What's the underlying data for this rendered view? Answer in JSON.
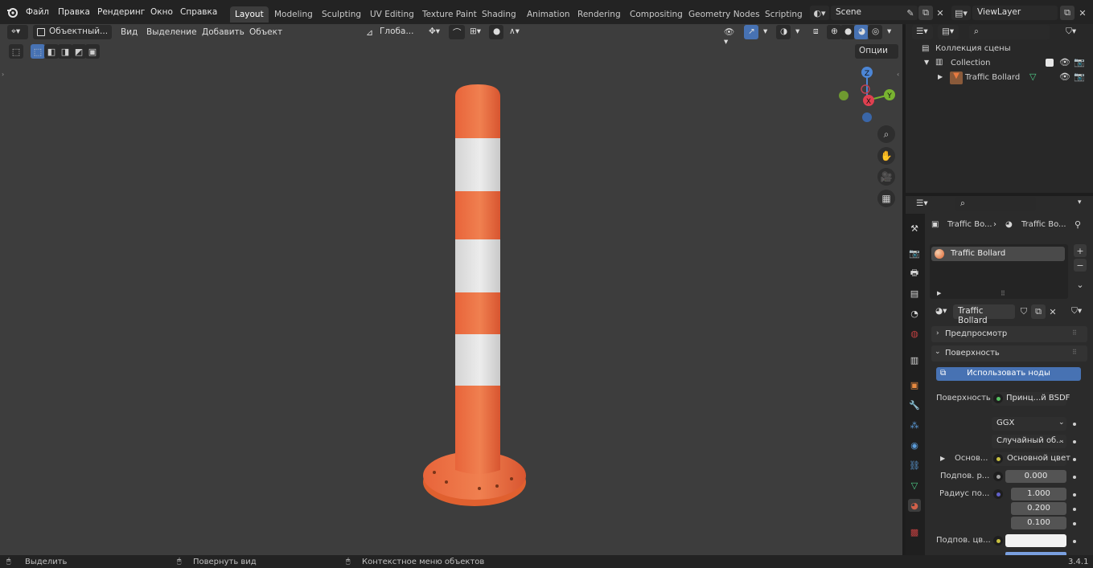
{
  "topbar": {
    "menus": [
      "Файл",
      "Правка",
      "Рендеринг",
      "Окно",
      "Справка"
    ],
    "workspaces": [
      "Layout",
      "Modeling",
      "Sculpting",
      "UV Editing",
      "Texture Paint",
      "Shading",
      "Animation",
      "Rendering",
      "Compositing",
      "Geometry Nodes",
      "Scripting"
    ],
    "active_workspace": "Layout",
    "scene": "Scene",
    "view_layer": "ViewLayer"
  },
  "viewport_header": {
    "mode": "Объектный...",
    "menus": [
      "Вид",
      "Выделение",
      "Добавить",
      "Объект"
    ],
    "orientation": "Глоба...",
    "options": "Опции"
  },
  "gizmo": {
    "z": "Z",
    "y": "Y",
    "x": "X"
  },
  "outliner": {
    "scene_collection": "Коллекция сцены",
    "collection": "Collection",
    "object": "Traffic Bollard"
  },
  "properties": {
    "breadcrumb_object": "Traffic Bo...",
    "breadcrumb_material": "Traffic Bo...",
    "material_slot": "Traffic Bollard",
    "material_name": "Traffic Bollard",
    "panel_preview": "Предпросмотр",
    "panel_surface": "Поверхность",
    "use_nodes_button": "Использовать ноды",
    "surface_label": "Поверхность",
    "surface_value": "Принц...й BSDF",
    "distribution": "GGX",
    "subsurface_method": "Случайный об...",
    "base_label": "Основ...",
    "base_value": "Основной цвет",
    "subsurface_label": "Подпов. р...",
    "subsurface_value": "0.000",
    "radius_label": "Радиус по...",
    "radius_values": [
      "1.000",
      "0.200",
      "0.100"
    ],
    "subsurface_color_label": "Подпов. цв..."
  },
  "statusbar": {
    "select": "Выделить",
    "rotate": "Повернуть вид",
    "context": "Контекстное меню объектов",
    "version": "3.4.1"
  },
  "colors": {
    "accent": "#4772b3",
    "bollard_orange": "#e8643a",
    "reflective_white": "#dcdcdc",
    "viewport_bg": "#3d3d3d"
  }
}
